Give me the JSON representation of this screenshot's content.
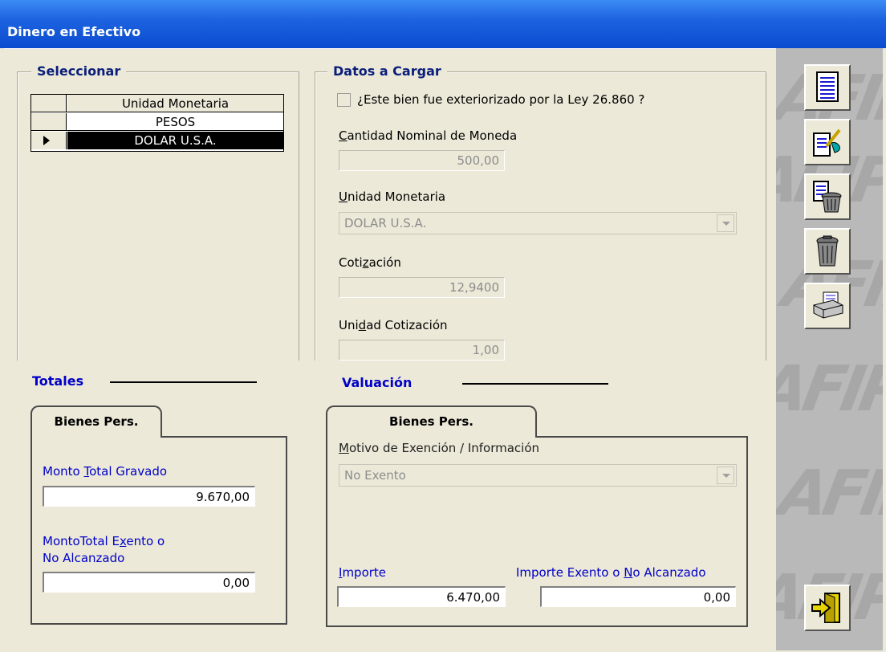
{
  "window": {
    "title": "Dinero en Efectivo"
  },
  "seleccionar": {
    "legend": "Seleccionar",
    "grid": {
      "header": "Unidad Monetaria",
      "rows": [
        "PESOS",
        "DOLAR U.S.A."
      ],
      "selected_index": 1
    }
  },
  "datos": {
    "legend": "Datos a Cargar",
    "checkbox_label": "¿Este bien fue exteriorizado por la Ley 26.860 ?",
    "checkbox_checked": false,
    "cantidad": {
      "label": "Cantidad Nominal de Moneda",
      "value": "500,00"
    },
    "unidad_monetaria": {
      "label": "Unidad Monetaria",
      "value": "DOLAR U.S.A."
    },
    "cotizacion": {
      "label": "Cotización",
      "value": "12,9400"
    },
    "unidad_cotizacion": {
      "label": "Unidad Cotización",
      "value": "1,00"
    }
  },
  "totales": {
    "heading": "Totales",
    "tab": "Bienes Pers.",
    "monto_gravado": {
      "label": "Monto Total Gravado",
      "value": "9.670,00"
    },
    "monto_exento": {
      "label_line1": "MontoTotal Exento o",
      "label_line2": "No Alcanzado",
      "value": "0,00"
    }
  },
  "valuacion": {
    "heading": "Valuación",
    "tab": "Bienes Pers.",
    "motivo": {
      "label": "Motivo de Exención / Información",
      "value": "No Exento"
    },
    "importe": {
      "label": "Importe",
      "value": "6.470,00"
    },
    "importe_exento": {
      "label": "Importe Exento o No Alcanzado",
      "value": "0,00"
    }
  },
  "toolbar": {
    "buttons": [
      "list-icon",
      "edit-icon",
      "delete-list-icon",
      "trash-icon",
      "printer-icon"
    ],
    "exit": "exit-door-icon"
  },
  "watermark": {
    "text": "AFIP"
  },
  "colors": {
    "title_bar": "#0a4ccf",
    "heading_blue": "#0000c8",
    "legend_blue": "#0a1e7a",
    "background": "#ece9d8",
    "side_panel": "#b9b9b9"
  }
}
